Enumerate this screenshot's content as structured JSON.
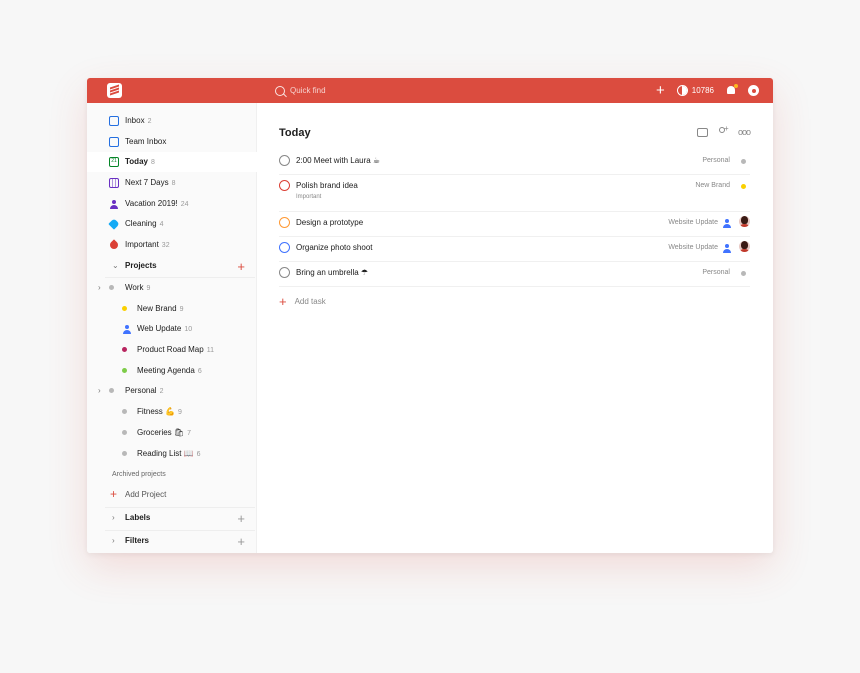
{
  "topbar": {
    "search_placeholder": "Quick find",
    "karma_count": "10786",
    "accent": "#db4c3f"
  },
  "sidebar": {
    "inbox": {
      "label": "Inbox",
      "count": "2"
    },
    "team_inbox": {
      "label": "Team Inbox"
    },
    "today": {
      "label": "Today",
      "count": "8"
    },
    "next7": {
      "label": "Next 7 Days",
      "count": "8"
    },
    "vacation": {
      "label": "Vacation 2019!",
      "count": "24"
    },
    "cleaning": {
      "label": "Cleaning",
      "count": "4"
    },
    "important": {
      "label": "Important",
      "count": "32"
    },
    "projects_label": "Projects",
    "work": {
      "label": "Work",
      "count": "9"
    },
    "new_brand": {
      "label": "New Brand",
      "count": "9"
    },
    "web_update": {
      "label": "Web Update",
      "count": "10"
    },
    "road_map": {
      "label": "Product Road Map",
      "count": "11"
    },
    "meeting": {
      "label": "Meeting Agenda",
      "count": "6"
    },
    "personal": {
      "label": "Personal",
      "count": "2"
    },
    "fitness": {
      "label": "Fitness 💪",
      "count": "9"
    },
    "groceries": {
      "label": "Groceries 🛍",
      "count": "7"
    },
    "reading": {
      "label": "Reading List 📖",
      "count": "6"
    },
    "archived": "Archived projects",
    "add_project": "Add Project",
    "labels": "Labels",
    "filters": "Filters"
  },
  "main": {
    "title": "Today",
    "tasks": [
      {
        "name": "2:00 Meet with Laura ☕",
        "project": "Personal",
        "circle": "#888888",
        "dot": "#b8b8b8"
      },
      {
        "name": "Polish brand idea",
        "sub": "Important",
        "project": "New Brand",
        "circle": "#db4035",
        "dot": "#fad000"
      },
      {
        "name": "Design a prototype",
        "project": "Website Update",
        "circle": "#ff9933"
      },
      {
        "name": "Organize photo shoot",
        "project": "Website Update",
        "circle": "#4073ff"
      },
      {
        "name": "Bring an umbrella ☂",
        "project": "Personal",
        "circle": "#888888",
        "dot": "#b8b8b8"
      }
    ],
    "add_task": "Add task"
  }
}
